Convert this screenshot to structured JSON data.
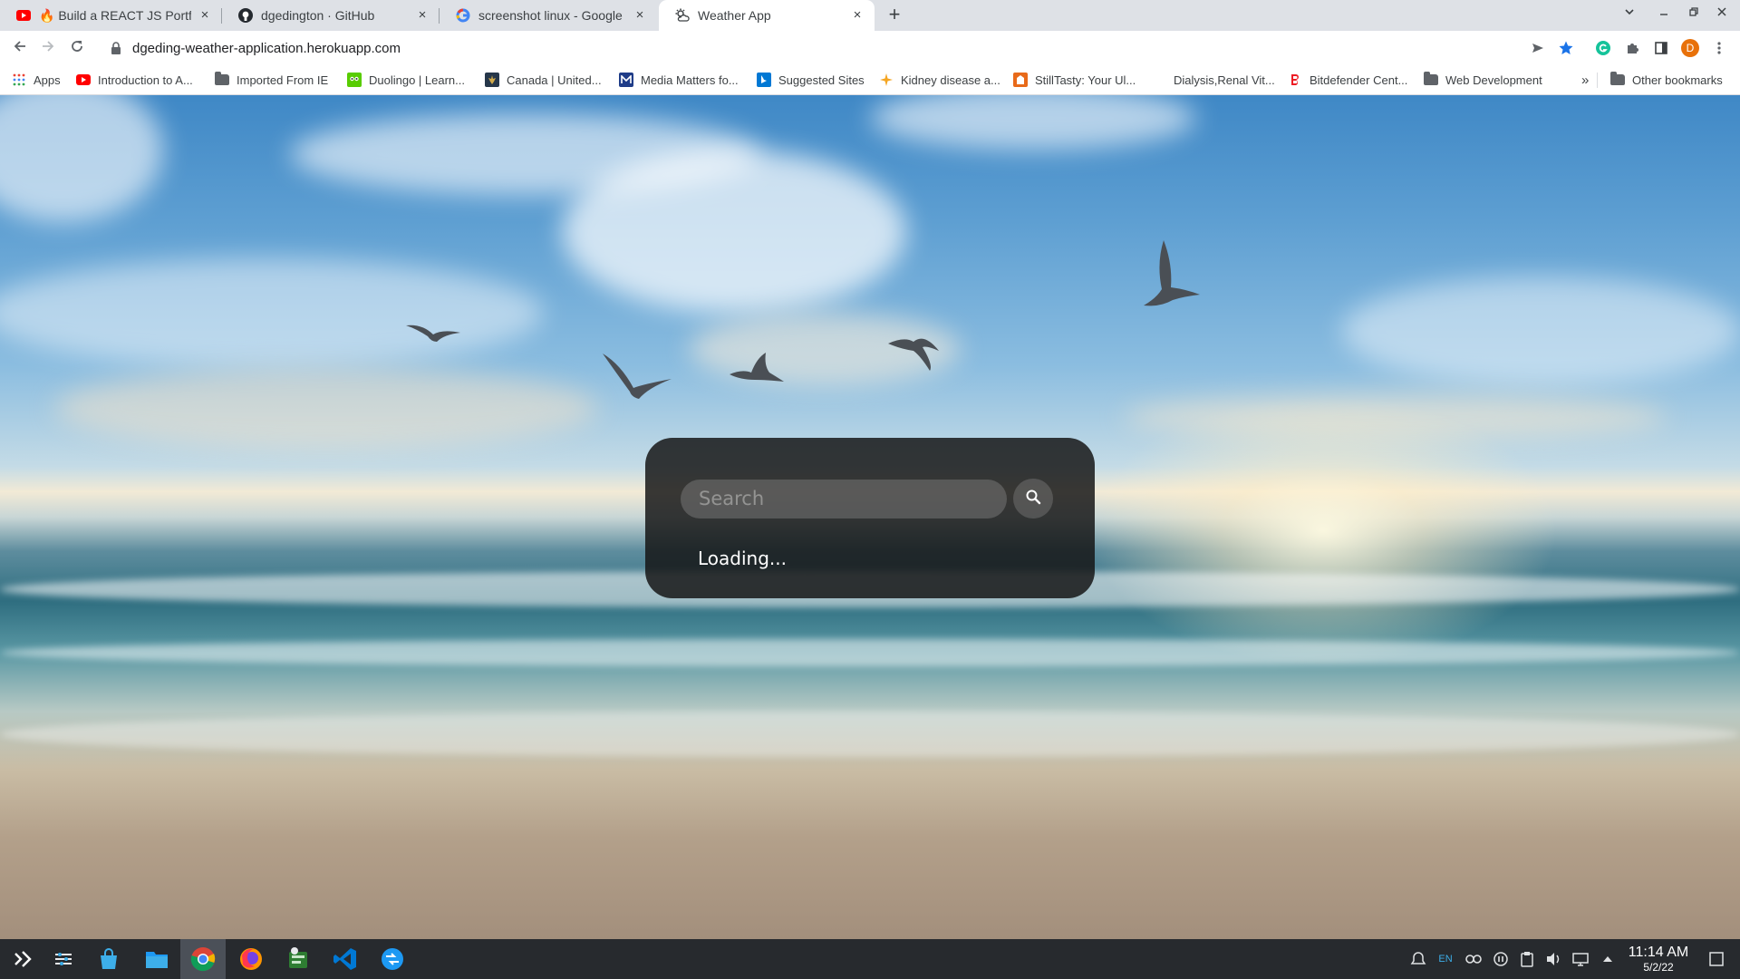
{
  "browser": {
    "tabs": [
      {
        "title": "🔥 Build a REACT JS Portfolio",
        "favicon": "youtube-icon",
        "active": false
      },
      {
        "title": "dgedington · GitHub",
        "favicon": "github-icon",
        "active": false
      },
      {
        "title": "screenshot linux - Google Sea",
        "favicon": "google-icon",
        "active": false
      },
      {
        "title": "Weather App",
        "favicon": "weather-icon",
        "active": true
      }
    ],
    "close_glyph": "×",
    "new_tab_glyph": "+",
    "url": "dgeding-weather-application.herokuapp.com",
    "profile_initial": "D"
  },
  "bookmarks": [
    {
      "label": "Apps",
      "icon": "apps-grid-icon"
    },
    {
      "label": "Introduction to A...",
      "icon": "youtube-icon"
    },
    {
      "label": "Imported From IE",
      "icon": "folder-icon"
    },
    {
      "label": "Duolingo | Learn...",
      "icon": "duolingo-icon"
    },
    {
      "label": "Canada | United...",
      "icon": "canada-icon"
    },
    {
      "label": "Media Matters fo...",
      "icon": "media-matters-icon"
    },
    {
      "label": "Suggested Sites",
      "icon": "bing-icon"
    },
    {
      "label": "Kidney disease a...",
      "icon": "star-burst-icon"
    },
    {
      "label": "StillTasty: Your Ul...",
      "icon": "stilltasty-icon"
    },
    {
      "label": "Dialysis,Renal Vit...",
      "icon": "blank-icon"
    },
    {
      "label": "Bitdefender Cent...",
      "icon": "bitdefender-icon"
    },
    {
      "label": "Web Development",
      "icon": "folder-icon"
    }
  ],
  "bookmarks_overflow": "»",
  "other_bookmarks": "Other bookmarks",
  "weather_app": {
    "search_placeholder": "Search",
    "search_value": "",
    "status": "Loading..."
  },
  "taskbar": {
    "apps": [
      "launcher-icon",
      "settings-icon",
      "store-icon",
      "files-icon",
      "chrome-icon",
      "firefox-icon",
      "tasks-icon",
      "vscode-icon",
      "kde-connect-icon"
    ],
    "active_app": "chrome-icon",
    "keyboard_layout": "EN",
    "time": "11:14 AM",
    "date": "5/2/22"
  }
}
